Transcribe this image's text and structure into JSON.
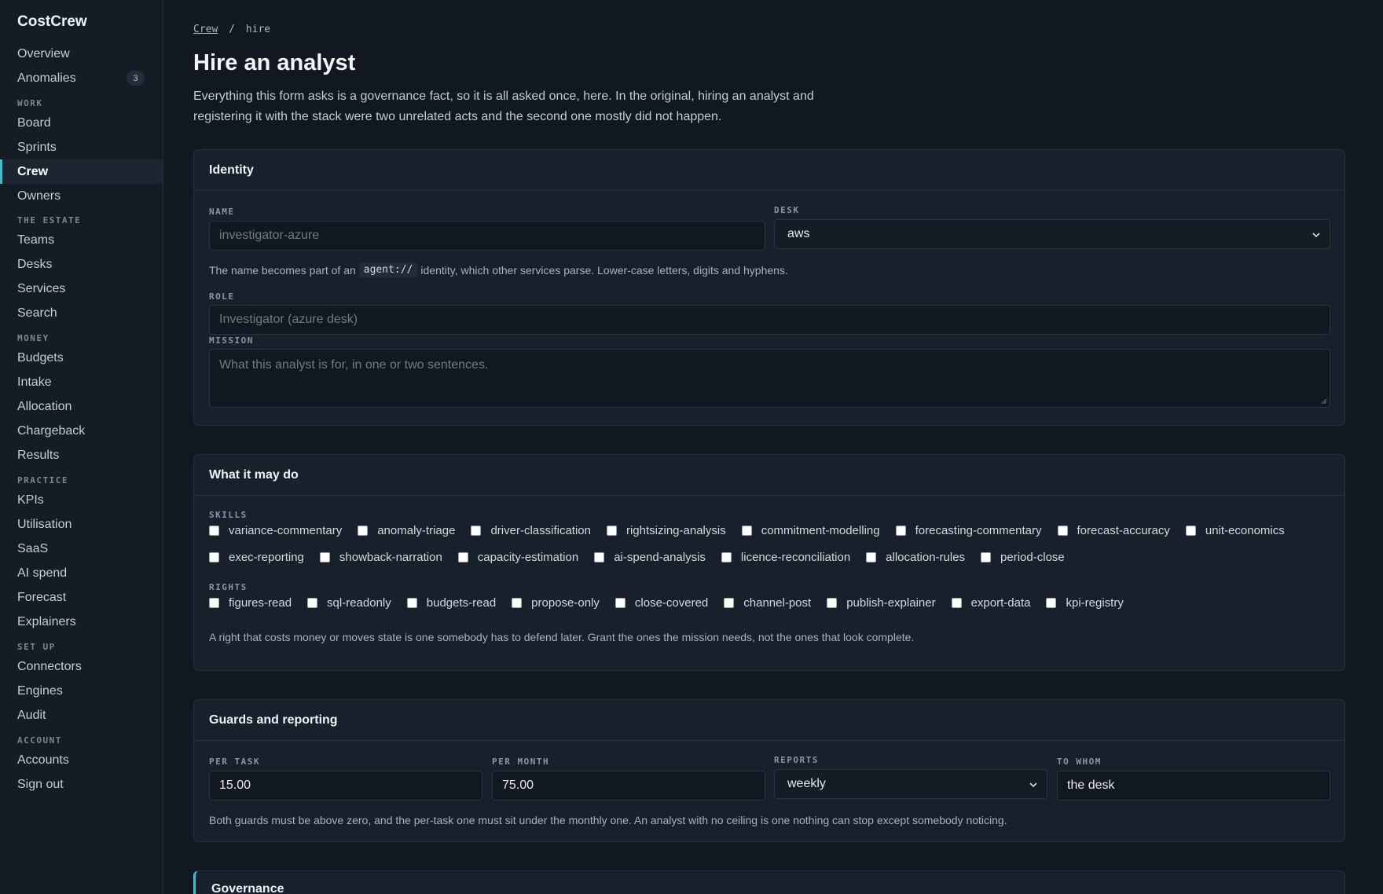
{
  "app": {
    "brand": "CostCrew"
  },
  "sidebar": {
    "top": [
      {
        "label": "Overview"
      },
      {
        "label": "Anomalies",
        "badge": "3"
      }
    ],
    "sections": [
      {
        "title": "WORK",
        "items": [
          "Board",
          "Sprints",
          "Crew",
          "Owners"
        ]
      },
      {
        "title": "THE ESTATE",
        "items": [
          "Teams",
          "Desks",
          "Services",
          "Search"
        ]
      },
      {
        "title": "MONEY",
        "items": [
          "Budgets",
          "Intake",
          "Allocation",
          "Chargeback",
          "Results"
        ]
      },
      {
        "title": "PRACTICE",
        "items": [
          "KPIs",
          "Utilisation",
          "SaaS",
          "AI spend",
          "Forecast",
          "Explainers"
        ]
      },
      {
        "title": "SET UP",
        "items": [
          "Connectors",
          "Engines",
          "Audit"
        ]
      },
      {
        "title": "ACCOUNT",
        "items": [
          "Accounts",
          "Sign out"
        ]
      }
    ],
    "active": "Crew"
  },
  "breadcrumb": {
    "link": "Crew",
    "separator": "/",
    "current": "hire"
  },
  "page": {
    "title": "Hire an analyst",
    "intro": "Everything this form asks is a governance fact, so it is all asked once, here. In the original, hiring an analyst and registering it with the stack were two unrelated acts and the second one mostly did not happen."
  },
  "identity": {
    "heading": "Identity",
    "name_label": "NAME",
    "name_placeholder": "investigator-azure",
    "desk_label": "DESK",
    "desk_value": "aws",
    "name_help_before": "The name becomes part of an",
    "name_help_code": "agent://",
    "name_help_after": "identity, which other services parse. Lower-case letters, digits and hyphens.",
    "role_label": "ROLE",
    "role_placeholder": "Investigator (azure desk)",
    "mission_label": "MISSION",
    "mission_placeholder": "What this analyst is for, in one or two sentences."
  },
  "permissions": {
    "heading": "What it may do",
    "skills_label": "SKILLS",
    "skills_row1": [
      "variance-commentary",
      "anomaly-triage",
      "driver-classification",
      "rightsizing-analysis",
      "commitment-modelling",
      "forecasting-commentary",
      "forecast-accuracy",
      "unit-economics"
    ],
    "skills_row2": [
      "exec-reporting",
      "showback-narration",
      "capacity-estimation",
      "ai-spend-analysis",
      "licence-reconciliation",
      "allocation-rules",
      "period-close"
    ],
    "rights_label": "RIGHTS",
    "rights": [
      "figures-read",
      "sql-readonly",
      "budgets-read",
      "propose-only",
      "close-covered",
      "channel-post",
      "publish-explainer",
      "export-data",
      "kpi-registry"
    ],
    "help": "A right that costs money or moves state is one somebody has to defend later. Grant the ones the mission needs, not the ones that look complete."
  },
  "guards": {
    "heading": "Guards and reporting",
    "per_task_label": "PER TASK",
    "per_task_value": "15.00",
    "per_month_label": "PER MONTH",
    "per_month_value": "75.00",
    "reports_label": "REPORTS",
    "reports_value": "weekly",
    "to_whom_label": "TO WHOM",
    "to_whom_value": "the desk",
    "help": "Both guards must be above zero, and the per-task one must sit under the monthly one. An analyst with no ceiling is one nothing can stop except somebody noticing."
  },
  "governance": {
    "heading": "Governance"
  },
  "colors": {
    "accent": "#3fbfc8",
    "background": "#111821",
    "card": "#18212b"
  }
}
